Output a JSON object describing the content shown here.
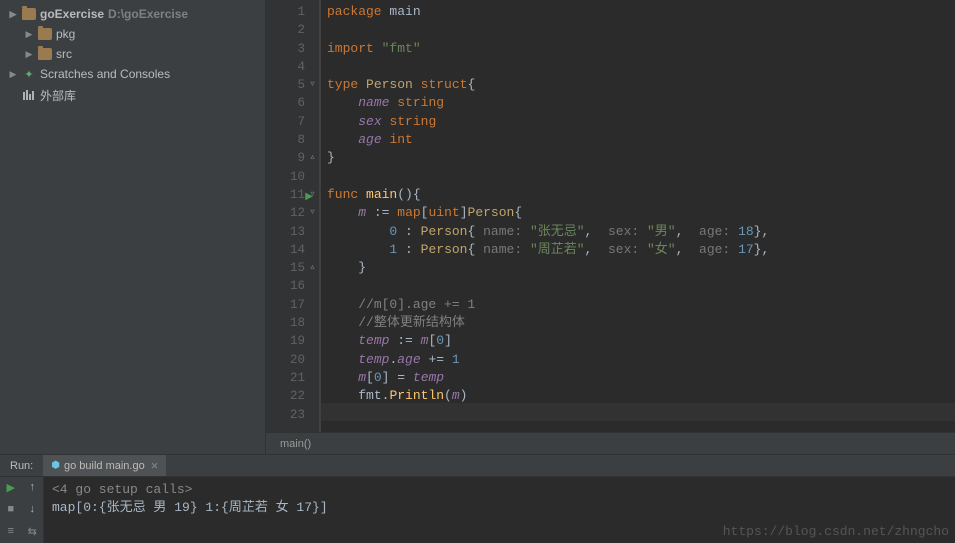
{
  "sidebar": {
    "items": [
      {
        "label": "goExercise",
        "path": "D:\\goExercise",
        "bold": true,
        "icon": "folder",
        "arrow": "▶"
      },
      {
        "label": "pkg",
        "icon": "folder",
        "arrow": "▶",
        "indent": 1
      },
      {
        "label": "src",
        "icon": "folder",
        "arrow": "▶",
        "indent": 1
      },
      {
        "label": "Scratches and Consoles",
        "icon": "scratch",
        "arrow": "▶"
      },
      {
        "label": "外部库",
        "icon": "lib",
        "arrow": ""
      }
    ]
  },
  "editor": {
    "line_count": 23,
    "highlight_line": 23,
    "code_tokens": [
      [
        {
          "t": "kw",
          "v": "package"
        },
        {
          "t": "sp"
        },
        {
          "t": "pkg",
          "v": "main"
        }
      ],
      [],
      [
        {
          "t": "kw",
          "v": "import"
        },
        {
          "t": "sp"
        },
        {
          "t": "str",
          "v": "\"fmt\""
        }
      ],
      [],
      [
        {
          "t": "kw",
          "v": "type"
        },
        {
          "t": "sp"
        },
        {
          "t": "type",
          "v": "Person"
        },
        {
          "t": "sp"
        },
        {
          "t": "kw",
          "v": "struct"
        },
        {
          "t": "op",
          "v": "{"
        }
      ],
      [
        {
          "t": "in"
        },
        {
          "t": "field",
          "v": "name"
        },
        {
          "t": "sp"
        },
        {
          "t": "builtin",
          "v": "string"
        }
      ],
      [
        {
          "t": "in"
        },
        {
          "t": "field",
          "v": "sex"
        },
        {
          "t": "sp"
        },
        {
          "t": "builtin",
          "v": "string"
        }
      ],
      [
        {
          "t": "in"
        },
        {
          "t": "field",
          "v": "age"
        },
        {
          "t": "sp"
        },
        {
          "t": "builtin",
          "v": "int"
        }
      ],
      [
        {
          "t": "op",
          "v": "}"
        }
      ],
      [],
      [
        {
          "t": "kw",
          "v": "func"
        },
        {
          "t": "sp"
        },
        {
          "t": "fn",
          "v": "main"
        },
        {
          "t": "op",
          "v": "(){"
        }
      ],
      [
        {
          "t": "in"
        },
        {
          "t": "field",
          "v": "m"
        },
        {
          "t": "sp"
        },
        {
          "t": "op",
          "v": ":="
        },
        {
          "t": "sp"
        },
        {
          "t": "builtin",
          "v": "map"
        },
        {
          "t": "op",
          "v": "["
        },
        {
          "t": "builtin",
          "v": "uint"
        },
        {
          "t": "op",
          "v": "]"
        },
        {
          "t": "type",
          "v": "Person"
        },
        {
          "t": "op",
          "v": "{"
        }
      ],
      [
        {
          "t": "in2"
        },
        {
          "t": "num",
          "v": "0"
        },
        {
          "t": "sp"
        },
        {
          "t": "op",
          "v": ":"
        },
        {
          "t": "sp"
        },
        {
          "t": "type",
          "v": "Person"
        },
        {
          "t": "op",
          "v": "{"
        },
        {
          "t": "sp"
        },
        {
          "t": "hint",
          "v": "name:"
        },
        {
          "t": "sp"
        },
        {
          "t": "str",
          "v": "\"张无忌\""
        },
        {
          "t": "op",
          "v": ","
        },
        {
          "t": "sp2"
        },
        {
          "t": "hint",
          "v": "sex:"
        },
        {
          "t": "sp"
        },
        {
          "t": "str",
          "v": "\"男\""
        },
        {
          "t": "op",
          "v": ","
        },
        {
          "t": "sp2"
        },
        {
          "t": "hint",
          "v": "age:"
        },
        {
          "t": "sp"
        },
        {
          "t": "num",
          "v": "18"
        },
        {
          "t": "op",
          "v": "},"
        }
      ],
      [
        {
          "t": "in2"
        },
        {
          "t": "num",
          "v": "1"
        },
        {
          "t": "sp"
        },
        {
          "t": "op",
          "v": ":"
        },
        {
          "t": "sp"
        },
        {
          "t": "type",
          "v": "Person"
        },
        {
          "t": "op",
          "v": "{"
        },
        {
          "t": "sp"
        },
        {
          "t": "hint",
          "v": "name:"
        },
        {
          "t": "sp"
        },
        {
          "t": "str",
          "v": "\"周芷若\""
        },
        {
          "t": "op",
          "v": ","
        },
        {
          "t": "sp2"
        },
        {
          "t": "hint",
          "v": "sex:"
        },
        {
          "t": "sp"
        },
        {
          "t": "str",
          "v": "\"女\""
        },
        {
          "t": "op",
          "v": ","
        },
        {
          "t": "sp2"
        },
        {
          "t": "hint",
          "v": "age:"
        },
        {
          "t": "sp"
        },
        {
          "t": "num",
          "v": "17"
        },
        {
          "t": "op",
          "v": "},"
        }
      ],
      [
        {
          "t": "in"
        },
        {
          "t": "op",
          "v": "}"
        }
      ],
      [],
      [
        {
          "t": "in"
        },
        {
          "t": "comment",
          "v": "//m[0].age += 1"
        }
      ],
      [
        {
          "t": "in"
        },
        {
          "t": "comment",
          "v": "//整体更新结构体"
        }
      ],
      [
        {
          "t": "in"
        },
        {
          "t": "field",
          "v": "temp"
        },
        {
          "t": "sp"
        },
        {
          "t": "op",
          "v": ":="
        },
        {
          "t": "sp"
        },
        {
          "t": "field",
          "v": "m"
        },
        {
          "t": "op",
          "v": "["
        },
        {
          "t": "num",
          "v": "0"
        },
        {
          "t": "op",
          "v": "]"
        }
      ],
      [
        {
          "t": "in"
        },
        {
          "t": "field",
          "v": "temp"
        },
        {
          "t": "op",
          "v": "."
        },
        {
          "t": "field",
          "v": "age"
        },
        {
          "t": "sp"
        },
        {
          "t": "op",
          "v": "+="
        },
        {
          "t": "sp"
        },
        {
          "t": "num",
          "v": "1"
        }
      ],
      [
        {
          "t": "in"
        },
        {
          "t": "field",
          "v": "m"
        },
        {
          "t": "op",
          "v": "["
        },
        {
          "t": "num",
          "v": "0"
        },
        {
          "t": "op",
          "v": "]"
        },
        {
          "t": "sp"
        },
        {
          "t": "op",
          "v": "="
        },
        {
          "t": "sp"
        },
        {
          "t": "field",
          "v": "temp"
        }
      ],
      [
        {
          "t": "in"
        },
        {
          "t": "ident",
          "v": "fmt"
        },
        {
          "t": "op",
          "v": "."
        },
        {
          "t": "fn",
          "v": "Println"
        },
        {
          "t": "op",
          "v": "("
        },
        {
          "t": "field",
          "v": "m"
        },
        {
          "t": "op",
          "v": ")"
        }
      ],
      []
    ],
    "breadcrumb": "main()"
  },
  "run_panel": {
    "label": "Run:",
    "tab": "go build main.go",
    "output": {
      "setup": "<4 go setup calls>",
      "line1": "map[0:{张无忌 男 19} 1:{周芷若 女 17}]"
    }
  },
  "watermark": "https://blog.csdn.net/zhngcho"
}
